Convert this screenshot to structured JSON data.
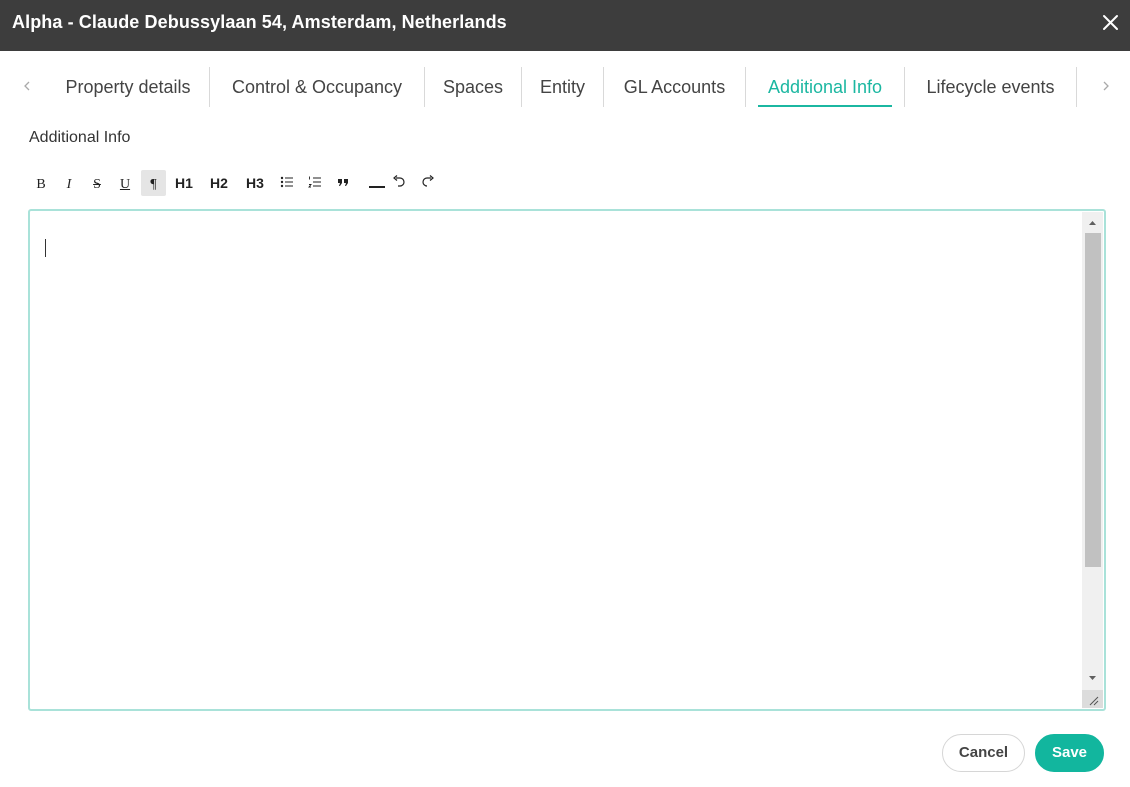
{
  "window": {
    "title": "Alpha - Claude Debussylaan 54, Amsterdam, Netherlands",
    "close_icon": "close-icon"
  },
  "tabs": {
    "prev_icon": "chevron-left-icon",
    "next_icon": "chevron-right-icon",
    "active_color": "#1bb7a1",
    "active_tab": "Additional Info",
    "items": [
      {
        "label": "Property details"
      },
      {
        "label": "Control & Occupancy"
      },
      {
        "label": "Spaces"
      },
      {
        "label": "Entity"
      },
      {
        "label": "GL Accounts"
      },
      {
        "label": "Additional Info"
      },
      {
        "label": "Lifecycle events"
      }
    ]
  },
  "section": {
    "label": "Additional Info"
  },
  "toolbar": {
    "active_tool": "paragraph",
    "tools": [
      {
        "name": "bold",
        "label": "B",
        "icon": "bold-icon"
      },
      {
        "name": "italic",
        "label": "I",
        "icon": "italic-icon"
      },
      {
        "name": "strikethrough",
        "label": "S",
        "icon": "strikethrough-icon"
      },
      {
        "name": "underline",
        "label": "U",
        "icon": "underline-icon"
      },
      {
        "name": "paragraph",
        "label": "¶",
        "icon": "paragraph-icon"
      },
      {
        "name": "heading-1",
        "label": "H1"
      },
      {
        "name": "heading-2",
        "label": "H2"
      },
      {
        "name": "heading-3",
        "label": "H3"
      },
      {
        "name": "bullet-list",
        "icon": "bullet-list-icon"
      },
      {
        "name": "ordered-list",
        "icon": "ordered-list-icon"
      },
      {
        "name": "blockquote",
        "icon": "quote-icon"
      },
      {
        "name": "horizontal-rule",
        "icon": "horizontal-rule-icon"
      },
      {
        "name": "undo",
        "icon": "undo-icon"
      },
      {
        "name": "redo",
        "icon": "redo-icon"
      }
    ]
  },
  "editor": {
    "value": "",
    "focus_border_color": "#a9e2d9"
  },
  "actions": {
    "cancel_label": "Cancel",
    "save_label": "Save",
    "save_color": "#12b69e"
  }
}
